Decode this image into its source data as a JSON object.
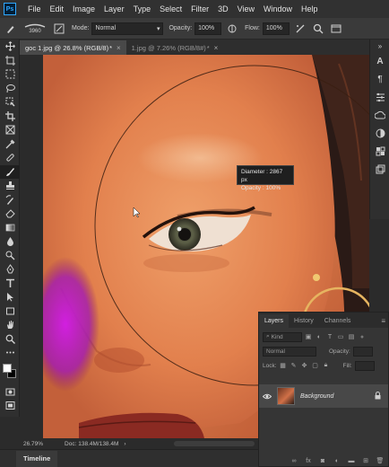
{
  "app": {
    "logo_text": "Ps"
  },
  "menu": [
    "File",
    "Edit",
    "Image",
    "Layer",
    "Type",
    "Select",
    "Filter",
    "3D",
    "View",
    "Window",
    "Help"
  ],
  "options": {
    "brush_size": "3960",
    "mode_label": "Mode:",
    "mode_value": "Normal",
    "opacity_label": "Opacity:",
    "opacity_value": "100%",
    "flow_label": "Flow:",
    "flow_value": "100%"
  },
  "tabs": [
    {
      "label": "goc 1.jpg @ 26.8% (RGB/8)",
      "modified": "*",
      "active": true
    },
    {
      "label": "1.jpg @ 7.26% (RGB/8#)",
      "modified": "*",
      "active": false
    }
  ],
  "brush_tooltip": {
    "diameter_label": "Diameter :",
    "diameter_value": "2867 px",
    "opacity_label": "Opacity :",
    "opacity_value": "100%"
  },
  "status": {
    "zoom": "26.79%",
    "doc_info": "Doc: 138.4M/138.4M"
  },
  "timeline": {
    "label": "Timeline"
  },
  "layers_panel": {
    "tabs": [
      "Layers",
      "History",
      "Channels"
    ],
    "filter_placeholder": "Kind",
    "blend_mode": "Normal",
    "opacity_label": "Opacity:",
    "lock_label": "Lock:",
    "fill_label": "Fill:",
    "layers": [
      {
        "name": "Background",
        "locked": true,
        "visible": true
      }
    ]
  },
  "colors": {
    "accent": "#31a8ff",
    "foreground_swatch": "#ffffff",
    "background_swatch": "#000000"
  }
}
